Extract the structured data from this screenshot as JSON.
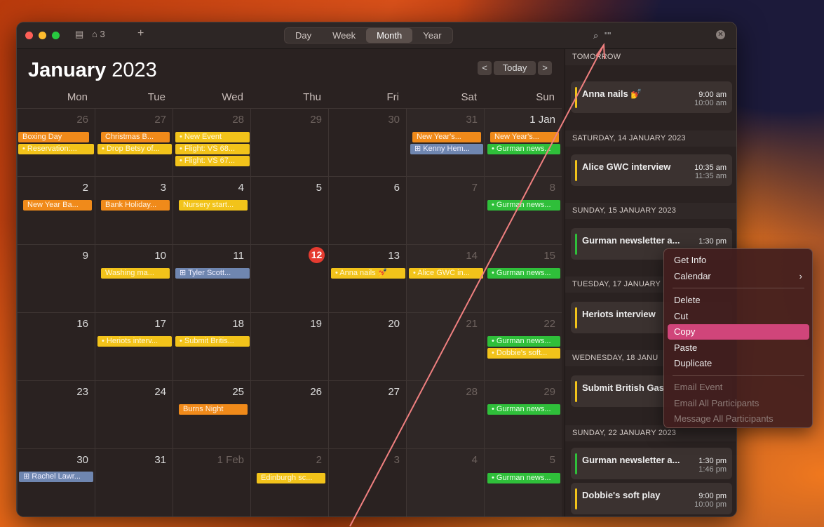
{
  "toolbar": {
    "badge_count": "3",
    "add_label": "+",
    "views": [
      "Day",
      "Week",
      "Month",
      "Year"
    ],
    "search_text": "\"\""
  },
  "header": {
    "month": "January",
    "year": "2023",
    "today_label": "Today",
    "prev": "<",
    "next": ">"
  },
  "weekdays": [
    "Mon",
    "Tue",
    "Wed",
    "Thu",
    "Fri",
    "Sat",
    "Sun"
  ],
  "weeks": [
    [
      "26",
      "27",
      "28",
      "29",
      "30",
      "31",
      "1 Jan"
    ],
    [
      "2",
      "3",
      "4",
      "5",
      "6",
      "7",
      "8"
    ],
    [
      "9",
      "10",
      "11",
      "12",
      "13",
      "14",
      "15"
    ],
    [
      "16",
      "17",
      "18",
      "19",
      "20",
      "21",
      "22"
    ],
    [
      "23",
      "24",
      "25",
      "26",
      "27",
      "28",
      "29"
    ],
    [
      "30",
      "31",
      "1 Feb",
      "2",
      "3",
      "4",
      "5"
    ]
  ],
  "events": {
    "w0": [
      "Boxing Day",
      "• Reservation:...",
      "Christmas B...",
      "• Drop Betsy of...",
      "• New Event",
      "• Flight: VS 68...",
      "• Flight: VS 67...",
      "New Year's...",
      "⊞ Kenny Hem...",
      "New Year's...",
      "• Gurman news..."
    ],
    "w1": [
      "New Year Ba...",
      "Bank Holiday...",
      "Nursery start...",
      "• Gurman news..."
    ],
    "w2": [
      "Washing ma...",
      "⊞ Tyler Scott...",
      "• Anna nails 💅",
      "• Alice GWC in...",
      "• Gurman news..."
    ],
    "w3": [
      "• Heriots interv...",
      "• Submit Britis...",
      "• Gurman news...",
      "• Dobbie's soft..."
    ],
    "w4": [
      "Burns Night",
      "• Gurman news..."
    ],
    "w5": [
      "⊞ Rachel Lawr...",
      "Edinburgh sc...",
      "• Gurman news..."
    ]
  },
  "sidebar": {
    "sections": [
      "TOMORROW",
      "SATURDAY, 14 JANUARY 2023",
      "SUNDAY, 15 JANUARY 2023",
      "TUESDAY, 17 JANUARY",
      "WEDNESDAY, 18 JANU",
      "SUNDAY, 22 JANUARY 2023"
    ],
    "cards": [
      {
        "title": "Anna nails 💅",
        "start": "9:00 am",
        "end": "10:00 am"
      },
      {
        "title": "Alice GWC interview",
        "start": "10:35 am",
        "end": "11:35 am"
      },
      {
        "title": "Gurman newsletter a...",
        "start": "1:30 pm",
        "end": ""
      },
      {
        "title": "Heriots interview",
        "start": "",
        "end": ""
      },
      {
        "title": "Submit British Gas",
        "start": "",
        "end": ""
      },
      {
        "title": "Gurman newsletter a...",
        "start": "1:30 pm",
        "end": "1:46 pm"
      },
      {
        "title": "Dobbie's soft play",
        "start": "9:00 pm",
        "end": "10:00 pm"
      }
    ]
  },
  "context_menu": {
    "items": [
      "Get Info",
      "Calendar",
      "Delete",
      "Cut",
      "Copy",
      "Paste",
      "Duplicate",
      "Email Event",
      "Email All Participants",
      "Message All Participants"
    ],
    "submenu_arrow": "›"
  },
  "colors": {
    "orange": "#f08a1a",
    "yellow": "#f2c31a",
    "green": "#2fbf3a",
    "blue": "#6f86b0",
    "today": "#e53b30",
    "highlight": "#d0457a"
  }
}
